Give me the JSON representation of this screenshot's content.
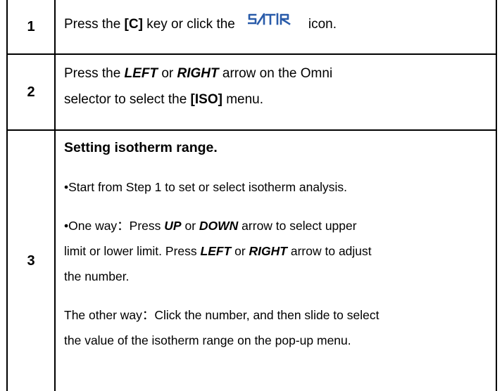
{
  "steps": [
    {
      "number": "1",
      "line1": {
        "t1": "Press the ",
        "key": "[C]",
        "t2": " key or click the",
        "t3": "icon."
      },
      "logo": {
        "text": "SATIR",
        "color": "#2a5caa",
        "icon_name": "satir-logo-icon"
      }
    },
    {
      "number": "2",
      "line1": {
        "t1": "Press the ",
        "left": "LEFT",
        "or": " or ",
        "right": "RIGHT",
        "t2": " arrow on the Omni"
      },
      "line2": {
        "t1": "selector to select the ",
        "menu": "[ISO]",
        "t2": " menu."
      }
    },
    {
      "number": "3",
      "heading": "Setting isotherm range.",
      "bullet1": "•Start from Step 1 to set or select isotherm analysis.",
      "bullet2_line1": {
        "t1": "•One way：Press ",
        "up": "UP",
        "or": " or ",
        "down": "DOWN",
        "t2": " arrow to select upper"
      },
      "bullet2_line2": {
        "t1": "limit or lower limit. Press ",
        "left": "LEFT",
        "or": " or ",
        "right": "RIGHT",
        "t2": " arrow to adjust"
      },
      "bullet2_line3": "the number.",
      "other_line1": "The other way：Click the number, and then slide to select",
      "other_line2": "the value of the isotherm range on the pop-up menu."
    }
  ]
}
